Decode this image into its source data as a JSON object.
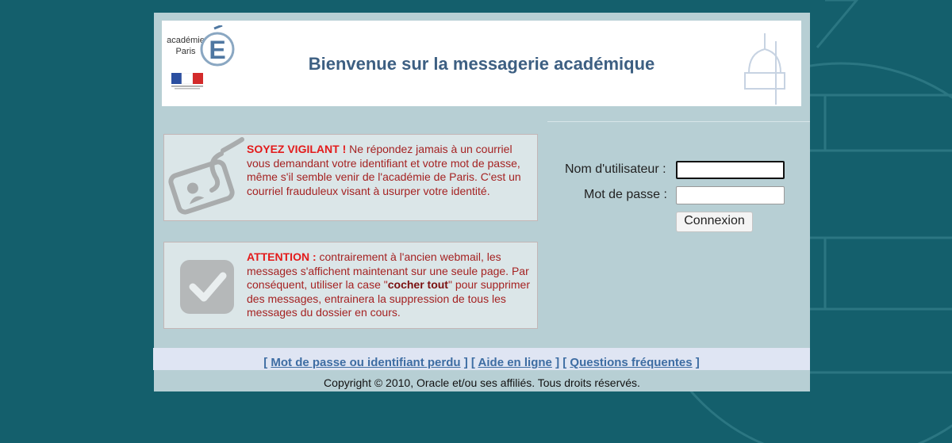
{
  "header": {
    "logo_text_line1": "académie",
    "logo_text_line2": "Paris",
    "title": "Bienvenue sur la messagerie académique"
  },
  "notices": [
    {
      "icon": "id-card-hook-icon",
      "strong": "SOYEZ VIGILANT !",
      "text": " Ne répondez jamais à un courriel vous demandant votre identifiant et votre mot de passe, même s'il semble venir de l'académie de Paris. C'est un courriel frauduleux visant à usurper votre identité."
    },
    {
      "icon": "checkbox-checked-icon",
      "strong": "ATTENTION :",
      "text_part1": " contrairement à l'ancien webmail, les messages s'affichent maintenant sur une seule page. Par conséquent, utiliser la case \"",
      "inner_strong": "cocher tout",
      "text_part2": "\" pour supprimer des messages, entrainera la suppression de tous les messages du dossier en cours."
    }
  ],
  "login": {
    "username_label": "Nom d'utilisateur :",
    "password_label": "Mot de passe :",
    "username_value": "",
    "password_value": "",
    "submit_label": "Connexion"
  },
  "footer": {
    "bracket_open": "[",
    "bracket_sep": "] [",
    "bracket_close": "]",
    "link_lost": "Mot de passe ou identifiant perdu",
    "link_help": "Aide en ligne",
    "link_faq": "Questions fréquentes",
    "copyright": "Copyright © 2010, Oracle et/ou ses affiliés. Tous droits réservés."
  },
  "colors": {
    "background": "#145f6c",
    "panel": "#b7cfd4",
    "title": "#3d5f82",
    "warning": "#e31b1b",
    "link": "#3e6da3"
  }
}
